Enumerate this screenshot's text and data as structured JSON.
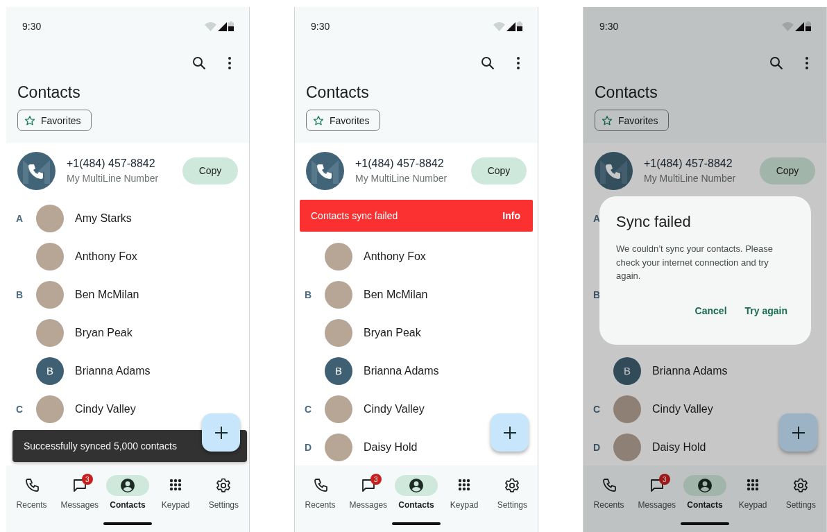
{
  "screens": [
    {
      "time": "9:30",
      "title": "Contacts",
      "chip": "Favorites",
      "my_number": {
        "number": "+1(484) 457-8842",
        "label": "My MultiLine Number",
        "button": "Copy"
      },
      "list": [
        {
          "kind": "contact",
          "letter": "A",
          "name": "Amy Starks"
        },
        {
          "kind": "contact",
          "name": "Anthony Fox"
        },
        {
          "kind": "contact",
          "letter": "B",
          "name": "Ben McMilan"
        },
        {
          "kind": "contact",
          "name": "Bryan Peak"
        },
        {
          "kind": "contact",
          "name": "Brianna Adams",
          "initial": "B"
        },
        {
          "kind": "contact",
          "letter": "C",
          "name": "Cindy Valley"
        }
      ],
      "snackbar": {
        "text": "Successfully synced 5,000 contacts"
      },
      "nav": [
        {
          "label": "Recents",
          "selected": false
        },
        {
          "label": "Messages",
          "badge": "3",
          "selected": false
        },
        {
          "label": "Contacts",
          "selected": true
        },
        {
          "label": "Keypad",
          "selected": false
        },
        {
          "label": "Settings",
          "selected": false
        }
      ]
    },
    {
      "time": "9:30",
      "title": "Contacts",
      "chip": "Favorites",
      "my_number": {
        "number": "+1(484) 457-8842",
        "label": "My MultiLine Number",
        "button": "Copy"
      },
      "list": [
        {
          "kind": "banner",
          "text": "Contacts sync failed",
          "action": "Info"
        },
        {
          "kind": "contact",
          "name": "Anthony Fox"
        },
        {
          "kind": "contact",
          "letter": "B",
          "name": "Ben McMilan"
        },
        {
          "kind": "contact",
          "name": "Bryan Peak"
        },
        {
          "kind": "contact",
          "name": "Brianna Adams",
          "initial": "B"
        },
        {
          "kind": "contact",
          "letter": "C",
          "name": "Cindy Valley"
        },
        {
          "kind": "contact",
          "letter": "D",
          "name": "Daisy Hold"
        }
      ],
      "nav": [
        {
          "label": "Recents",
          "selected": false
        },
        {
          "label": "Messages",
          "badge": "3",
          "selected": false
        },
        {
          "label": "Contacts",
          "selected": true
        },
        {
          "label": "Keypad",
          "selected": false
        },
        {
          "label": "Settings",
          "selected": false
        }
      ]
    },
    {
      "time": "9:30",
      "title": "Contacts",
      "chip": "Favorites",
      "dimmed": true,
      "my_number": {
        "number": "+1(484) 457-8842",
        "label": "My MultiLine Number",
        "button": "Copy"
      },
      "list": [
        {
          "kind": "covered",
          "letter": "A"
        },
        {
          "kind": "covered"
        },
        {
          "kind": "covered",
          "letter": "B"
        },
        {
          "kind": "covered"
        },
        {
          "kind": "contact",
          "name": "Brianna Adams",
          "initial": "B"
        },
        {
          "kind": "contact",
          "letter": "C",
          "name": "Cindy Valley"
        },
        {
          "kind": "contact",
          "letter": "D",
          "name": "Daisy Hold"
        }
      ],
      "dialog": {
        "title": "Sync failed",
        "body": "We couldn’t sync your contacts. Please check your internet connection and try again.",
        "buttons": [
          "Cancel",
          "Try again"
        ]
      },
      "nav": [
        {
          "label": "Recents",
          "selected": false
        },
        {
          "label": "Messages",
          "badge": "3",
          "selected": false
        },
        {
          "label": "Contacts",
          "selected": true
        },
        {
          "label": "Keypad",
          "selected": false
        },
        {
          "label": "Settings",
          "selected": false
        }
      ]
    }
  ]
}
